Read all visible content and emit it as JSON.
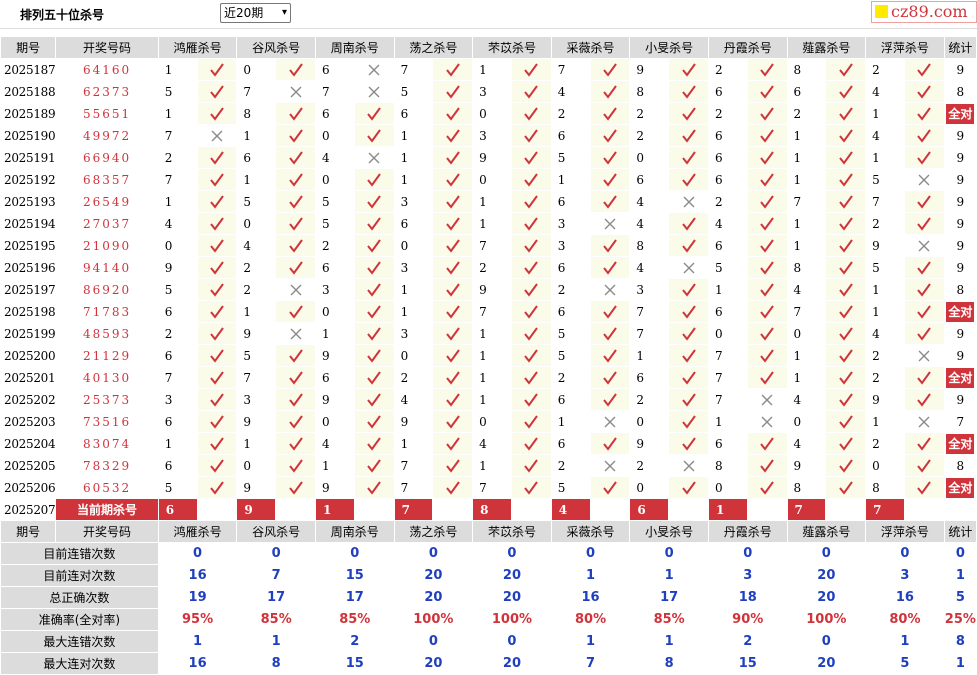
{
  "header": {
    "title": "排列五十位杀号",
    "period_select": "近20期",
    "logo_text": "cz89.com"
  },
  "colors": {
    "accent": "#d0343b",
    "header_bg": "#dcdcdc",
    "highlight_bg": "#fbfbe9",
    "sum_blue": "#1f3fbf",
    "logo_square": "#ffea00"
  },
  "columns": {
    "issue": "期号",
    "open": "开奖号码",
    "experts": [
      "鸿雁杀号",
      "谷风杀号",
      "周南杀号",
      "荡之杀号",
      "芣苡杀号",
      "采薇杀号",
      "小旻杀号",
      "丹霞杀号",
      "薤露杀号",
      "浮萍杀号"
    ],
    "stat": "统计"
  },
  "rows": [
    {
      "issue": "2025187",
      "open": "64160",
      "picks": [
        [
          1,
          1
        ],
        [
          0,
          1
        ],
        [
          6,
          0
        ],
        [
          7,
          1
        ],
        [
          1,
          1
        ],
        [
          7,
          1
        ],
        [
          9,
          1
        ],
        [
          2,
          1
        ],
        [
          8,
          1
        ],
        [
          2,
          1
        ]
      ],
      "stat": "9"
    },
    {
      "issue": "2025188",
      "open": "62373",
      "picks": [
        [
          5,
          1
        ],
        [
          7,
          0
        ],
        [
          7,
          0
        ],
        [
          5,
          1
        ],
        [
          3,
          1
        ],
        [
          4,
          1
        ],
        [
          8,
          1
        ],
        [
          6,
          1
        ],
        [
          6,
          1
        ],
        [
          4,
          1
        ]
      ],
      "stat": "8"
    },
    {
      "issue": "2025189",
      "open": "55651",
      "picks": [
        [
          1,
          1
        ],
        [
          8,
          1
        ],
        [
          6,
          1
        ],
        [
          6,
          1
        ],
        [
          0,
          1
        ],
        [
          2,
          1
        ],
        [
          2,
          1
        ],
        [
          2,
          1
        ],
        [
          2,
          1
        ],
        [
          1,
          1
        ]
      ],
      "stat": "全对"
    },
    {
      "issue": "2025190",
      "open": "49972",
      "picks": [
        [
          7,
          0
        ],
        [
          1,
          1
        ],
        [
          0,
          1
        ],
        [
          1,
          1
        ],
        [
          3,
          1
        ],
        [
          6,
          1
        ],
        [
          2,
          1
        ],
        [
          6,
          1
        ],
        [
          1,
          1
        ],
        [
          4,
          1
        ]
      ],
      "stat": "9"
    },
    {
      "issue": "2025191",
      "open": "66940",
      "picks": [
        [
          2,
          1
        ],
        [
          6,
          1
        ],
        [
          4,
          0
        ],
        [
          1,
          1
        ],
        [
          9,
          1
        ],
        [
          5,
          1
        ],
        [
          0,
          1
        ],
        [
          6,
          1
        ],
        [
          1,
          1
        ],
        [
          1,
          1
        ]
      ],
      "stat": "9"
    },
    {
      "issue": "2025192",
      "open": "68357",
      "picks": [
        [
          7,
          1
        ],
        [
          1,
          1
        ],
        [
          0,
          1
        ],
        [
          1,
          1
        ],
        [
          0,
          1
        ],
        [
          1,
          1
        ],
        [
          6,
          1
        ],
        [
          6,
          1
        ],
        [
          1,
          1
        ],
        [
          5,
          0
        ]
      ],
      "stat": "9"
    },
    {
      "issue": "2025193",
      "open": "26549",
      "picks": [
        [
          1,
          1
        ],
        [
          5,
          1
        ],
        [
          5,
          1
        ],
        [
          3,
          1
        ],
        [
          1,
          1
        ],
        [
          6,
          1
        ],
        [
          4,
          0
        ],
        [
          2,
          1
        ],
        [
          7,
          1
        ],
        [
          7,
          1
        ]
      ],
      "stat": "9"
    },
    {
      "issue": "2025194",
      "open": "27037",
      "picks": [
        [
          4,
          1
        ],
        [
          0,
          1
        ],
        [
          5,
          1
        ],
        [
          6,
          1
        ],
        [
          1,
          1
        ],
        [
          3,
          0
        ],
        [
          4,
          1
        ],
        [
          4,
          1
        ],
        [
          1,
          1
        ],
        [
          2,
          1
        ]
      ],
      "stat": "9"
    },
    {
      "issue": "2025195",
      "open": "21090",
      "picks": [
        [
          0,
          1
        ],
        [
          4,
          1
        ],
        [
          2,
          1
        ],
        [
          0,
          1
        ],
        [
          7,
          1
        ],
        [
          3,
          1
        ],
        [
          8,
          1
        ],
        [
          6,
          1
        ],
        [
          1,
          1
        ],
        [
          9,
          0
        ]
      ],
      "stat": "9"
    },
    {
      "issue": "2025196",
      "open": "94140",
      "picks": [
        [
          9,
          1
        ],
        [
          2,
          1
        ],
        [
          6,
          1
        ],
        [
          3,
          1
        ],
        [
          2,
          1
        ],
        [
          6,
          1
        ],
        [
          4,
          0
        ],
        [
          5,
          1
        ],
        [
          8,
          1
        ],
        [
          5,
          1
        ]
      ],
      "stat": "9"
    },
    {
      "issue": "2025197",
      "open": "86920",
      "picks": [
        [
          5,
          1
        ],
        [
          2,
          0
        ],
        [
          3,
          1
        ],
        [
          1,
          1
        ],
        [
          9,
          1
        ],
        [
          2,
          0
        ],
        [
          3,
          1
        ],
        [
          1,
          1
        ],
        [
          4,
          1
        ],
        [
          1,
          1
        ]
      ],
      "stat": "8"
    },
    {
      "issue": "2025198",
      "open": "71783",
      "picks": [
        [
          6,
          1
        ],
        [
          1,
          1
        ],
        [
          0,
          1
        ],
        [
          1,
          1
        ],
        [
          7,
          1
        ],
        [
          6,
          1
        ],
        [
          7,
          1
        ],
        [
          6,
          1
        ],
        [
          7,
          1
        ],
        [
          1,
          1
        ]
      ],
      "stat": "全对"
    },
    {
      "issue": "2025199",
      "open": "48593",
      "picks": [
        [
          2,
          1
        ],
        [
          9,
          0
        ],
        [
          1,
          1
        ],
        [
          3,
          1
        ],
        [
          1,
          1
        ],
        [
          5,
          1
        ],
        [
          7,
          1
        ],
        [
          0,
          1
        ],
        [
          0,
          1
        ],
        [
          4,
          1
        ]
      ],
      "stat": "9"
    },
    {
      "issue": "2025200",
      "open": "21129",
      "picks": [
        [
          6,
          1
        ],
        [
          5,
          1
        ],
        [
          9,
          1
        ],
        [
          0,
          1
        ],
        [
          1,
          1
        ],
        [
          5,
          1
        ],
        [
          1,
          1
        ],
        [
          7,
          1
        ],
        [
          1,
          1
        ],
        [
          2,
          0
        ]
      ],
      "stat": "9"
    },
    {
      "issue": "2025201",
      "open": "40130",
      "picks": [
        [
          7,
          1
        ],
        [
          7,
          1
        ],
        [
          6,
          1
        ],
        [
          2,
          1
        ],
        [
          1,
          1
        ],
        [
          2,
          1
        ],
        [
          6,
          1
        ],
        [
          7,
          1
        ],
        [
          1,
          1
        ],
        [
          2,
          1
        ]
      ],
      "stat": "全对"
    },
    {
      "issue": "2025202",
      "open": "25373",
      "picks": [
        [
          3,
          1
        ],
        [
          3,
          1
        ],
        [
          9,
          1
        ],
        [
          4,
          1
        ],
        [
          1,
          1
        ],
        [
          6,
          1
        ],
        [
          2,
          1
        ],
        [
          7,
          0
        ],
        [
          4,
          1
        ],
        [
          9,
          1
        ]
      ],
      "stat": "9"
    },
    {
      "issue": "2025203",
      "open": "73516",
      "picks": [
        [
          6,
          1
        ],
        [
          9,
          1
        ],
        [
          0,
          1
        ],
        [
          9,
          1
        ],
        [
          0,
          1
        ],
        [
          1,
          0
        ],
        [
          0,
          1
        ],
        [
          1,
          0
        ],
        [
          0,
          1
        ],
        [
          1,
          0
        ]
      ],
      "stat": "7"
    },
    {
      "issue": "2025204",
      "open": "83074",
      "picks": [
        [
          1,
          1
        ],
        [
          1,
          1
        ],
        [
          4,
          1
        ],
        [
          1,
          1
        ],
        [
          4,
          1
        ],
        [
          6,
          1
        ],
        [
          9,
          1
        ],
        [
          6,
          1
        ],
        [
          4,
          1
        ],
        [
          2,
          1
        ]
      ],
      "stat": "全对"
    },
    {
      "issue": "2025205",
      "open": "78329",
      "picks": [
        [
          6,
          1
        ],
        [
          0,
          1
        ],
        [
          1,
          1
        ],
        [
          7,
          1
        ],
        [
          1,
          1
        ],
        [
          2,
          0
        ],
        [
          2,
          0
        ],
        [
          8,
          1
        ],
        [
          9,
          1
        ],
        [
          0,
          1
        ]
      ],
      "stat": "8"
    },
    {
      "issue": "2025206",
      "open": "60532",
      "picks": [
        [
          5,
          1
        ],
        [
          9,
          1
        ],
        [
          9,
          1
        ],
        [
          7,
          1
        ],
        [
          7,
          1
        ],
        [
          5,
          1
        ],
        [
          0,
          1
        ],
        [
          0,
          1
        ],
        [
          8,
          1
        ],
        [
          8,
          1
        ]
      ],
      "stat": "全对"
    }
  ],
  "current": {
    "issue": "2025207",
    "label": "当前期杀号",
    "picks": [
      "6",
      "9",
      "1",
      "7",
      "8",
      "4",
      "6",
      "1",
      "7",
      "7"
    ]
  },
  "summary": [
    {
      "label": "目前连错次数",
      "values": [
        "0",
        "0",
        "0",
        "0",
        "0",
        "0",
        "0",
        "0",
        "0",
        "0"
      ],
      "stat": "0",
      "red": false
    },
    {
      "label": "目前连对次数",
      "values": [
        "16",
        "7",
        "15",
        "20",
        "20",
        "1",
        "1",
        "3",
        "20",
        "3"
      ],
      "stat": "1",
      "red": false
    },
    {
      "label": "总正确次数",
      "values": [
        "19",
        "17",
        "17",
        "20",
        "20",
        "16",
        "17",
        "18",
        "20",
        "16"
      ],
      "stat": "5",
      "red": false
    },
    {
      "label": "准确率(全对率)",
      "values": [
        "95%",
        "85%",
        "85%",
        "100%",
        "100%",
        "80%",
        "85%",
        "90%",
        "100%",
        "80%"
      ],
      "stat": "25%",
      "red": true
    },
    {
      "label": "最大连错次数",
      "values": [
        "1",
        "1",
        "2",
        "0",
        "0",
        "1",
        "1",
        "2",
        "0",
        "1"
      ],
      "stat": "8",
      "red": false
    },
    {
      "label": "最大连对次数",
      "values": [
        "16",
        "8",
        "15",
        "20",
        "20",
        "7",
        "8",
        "15",
        "20",
        "5"
      ],
      "stat": "1",
      "red": false
    }
  ]
}
